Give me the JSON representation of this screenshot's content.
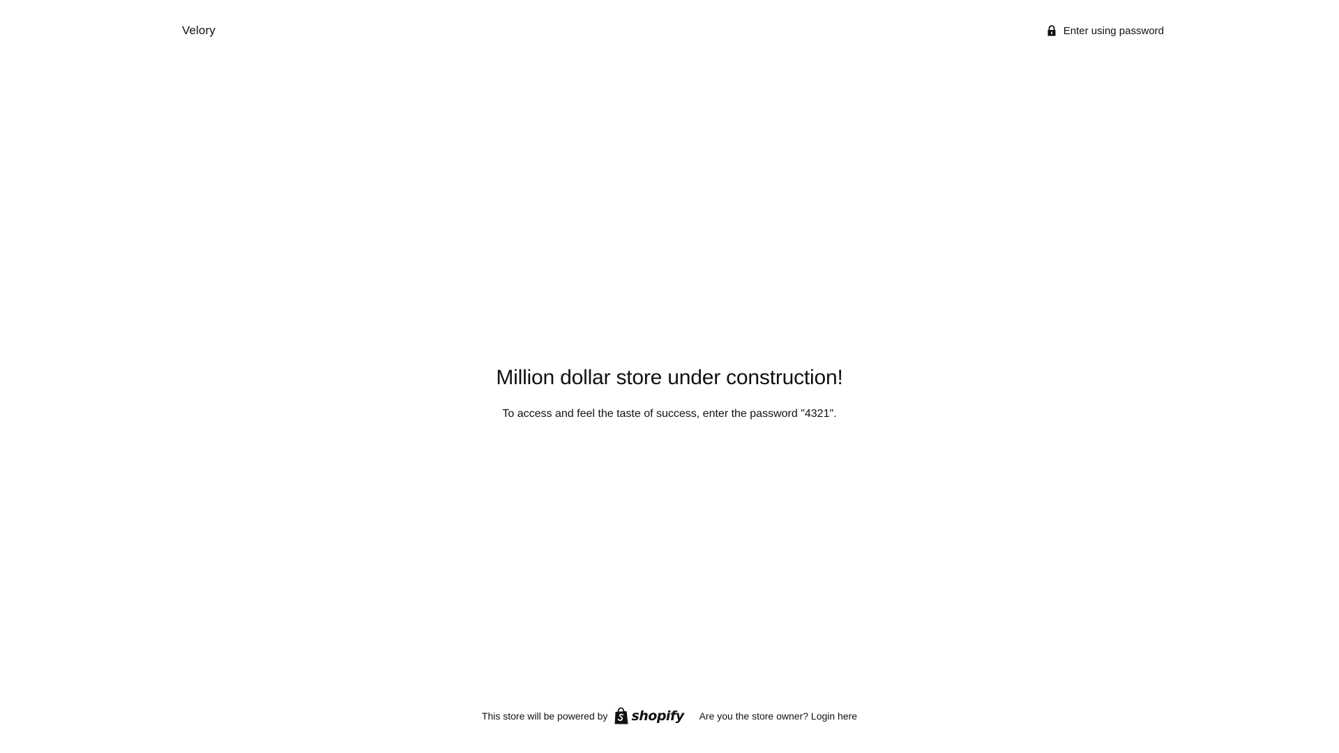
{
  "header": {
    "brand": "Velory",
    "enter_link_label": "Enter using password",
    "lock_icon": "lock-icon"
  },
  "main": {
    "headline": "Million dollar store under construction!",
    "message": "To access and feel the taste of success, enter the password \"4321\"."
  },
  "footer": {
    "powered_by_text": "This store will be powered by",
    "shopify_logo_text": "shopify",
    "owner_question": "Are you the store owner?",
    "login_link": "Login here"
  }
}
